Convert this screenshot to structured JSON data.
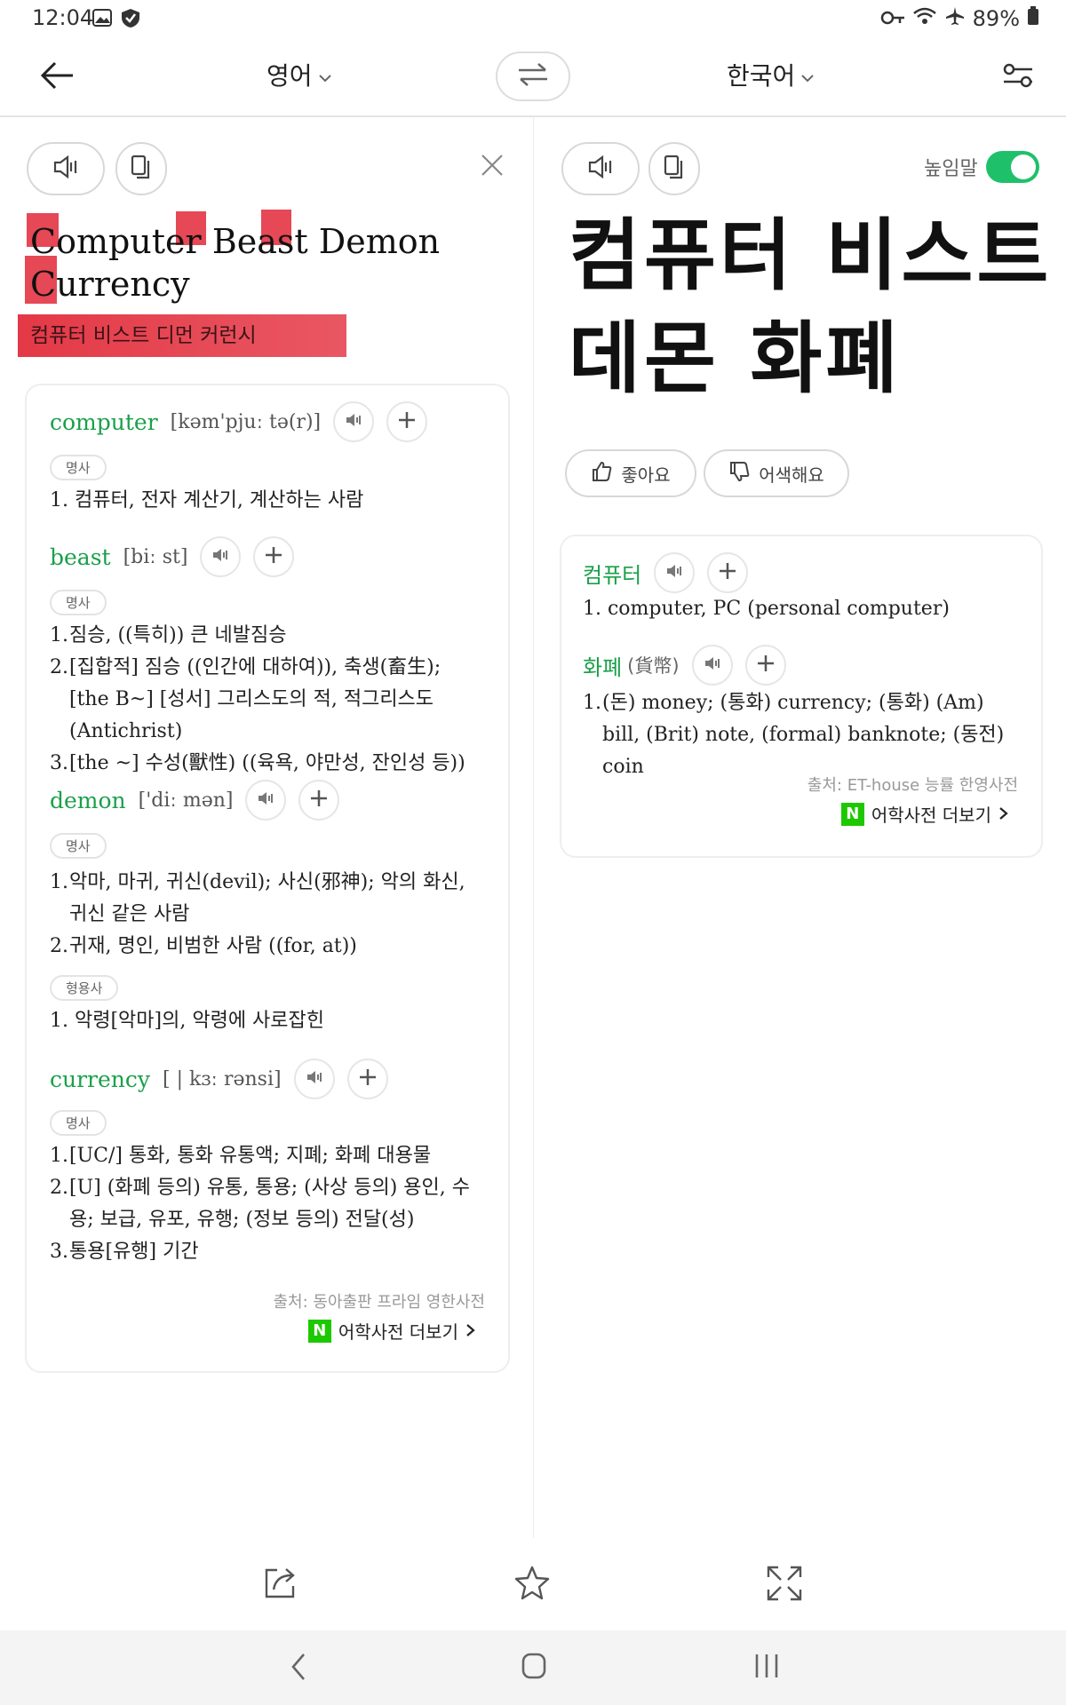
{
  "status": {
    "time": "12:04",
    "battery": "89%"
  },
  "header": {
    "source_lang": "영어",
    "target_lang": "한국어"
  },
  "source": {
    "text_line1_words": [
      "Computer",
      "Beast",
      "Demon"
    ],
    "text_line2": "Currency",
    "phonetic": "컴퓨터 비스트 디먼 커런시"
  },
  "target": {
    "honorific_label": "높임말",
    "translation_line1": "컴퓨터 비스트",
    "translation_line2": "데몬 화폐",
    "like_label": "좋아요",
    "dislike_label": "어색해요"
  },
  "left_dict": {
    "entries": [
      {
        "word": "computer",
        "pron": "[kəm'pjuː tə(r)]",
        "groups": [
          {
            "pos": "명사",
            "defs": [
              "컴퓨터, 전자 계산기, 계산하는 사람"
            ]
          }
        ]
      },
      {
        "word": "beast",
        "pron": "[biː st]",
        "groups": [
          {
            "pos": "명사",
            "defs": [
              "짐승, ((특히)) 큰 네발짐승",
              "[집합적] 짐승 ((인간에 대하여)), 축생(畜生); [the B~] [성서] 그리스도의 적, 적그리스도(Antichrist)",
              "[the ~] 수성(獸性) ((육욕, 야만성, 잔인성 등))"
            ]
          }
        ]
      },
      {
        "word": "demon",
        "pron": "['diː mən]",
        "groups": [
          {
            "pos": "명사",
            "defs": [
              "악마, 마귀, 귀신(devil); 사신(邪神); 악의 화신, 귀신 같은 사람",
              "귀재, 명인, 비범한 사람 ((for, at))"
            ]
          },
          {
            "pos": "형용사",
            "defs": [
              "악령[악마]의, 악령에 사로잡힌"
            ]
          }
        ]
      },
      {
        "word": "currency",
        "pron": "[ | kɜː rənsi]",
        "groups": [
          {
            "pos": "명사",
            "defs": [
              "[UC/] 통화, 통화 유통액; 지폐; 화폐 대용물",
              "[U] (화폐 등의) 유통, 통용; (사상 등의) 용인, 수용; 보급, 유포, 유행; (정보 등의) 전달(성)",
              "통용[유행] 기간"
            ]
          }
        ]
      }
    ],
    "source": "출처: 동아출판 프라임 영한사전",
    "more": "어학사전 더보기"
  },
  "right_dict": {
    "entries": [
      {
        "word": "컴퓨터",
        "hanja": "",
        "defs": [
          "computer, PC (personal computer)"
        ]
      },
      {
        "word": "화폐",
        "hanja": "(貨幣)",
        "defs": [
          "(돈) money; (통화) currency; (통화) (Am) bill, (Brit) note, (formal) banknote; (동전) coin"
        ]
      }
    ],
    "source": "출처: ET-house 능률 한영사전",
    "more": "어학사전 더보기"
  },
  "icons": [
    "back-arrow-icon",
    "chevron-down-icon",
    "swap-icon",
    "settings-sliders-icon",
    "speaker-icon",
    "copy-icon",
    "close-icon",
    "thumbs-up-icon",
    "thumbs-down-icon",
    "plus-icon",
    "share-icon",
    "star-icon",
    "expand-icon"
  ],
  "colors": {
    "accent_green": "#1aa04a",
    "toggle_green": "#1ec16a",
    "highlight_red": "#e22837",
    "naver_green": "#1ec800"
  }
}
